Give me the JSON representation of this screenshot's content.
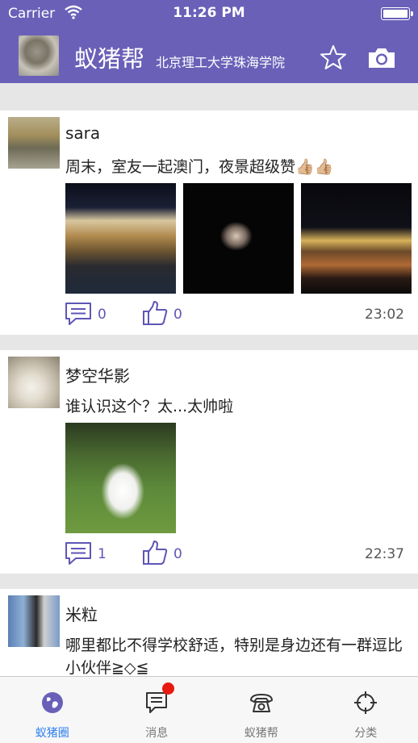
{
  "status_bar": {
    "carrier": "Carrier",
    "time": "11:26 PM"
  },
  "header": {
    "title": "蚁猪帮",
    "subtitle": "北京理工大学珠海学院"
  },
  "posts": [
    {
      "author": "sara",
      "text": "周末，室友一起澳门，夜景超级赞👍🏼👍🏼",
      "comments": "0",
      "likes": "0",
      "time": "23:02"
    },
    {
      "author": "梦空华影",
      "text": "谁认识这个？太...太帅啦",
      "comments": "1",
      "likes": "0",
      "time": "22:37"
    },
    {
      "author": "米粒",
      "text": "哪里都比不得学校舒适，特别是身边还有一群逗比小伙伴≧◇≦"
    }
  ],
  "tabs": [
    {
      "label": "蚁猪圈",
      "icon": "globe-icon",
      "active": true
    },
    {
      "label": "消息",
      "icon": "message-icon"
    },
    {
      "label": "蚁猪帮",
      "icon": "telephone-icon"
    },
    {
      "label": "分类",
      "icon": "crosshair-icon"
    }
  ],
  "colors": {
    "brand": "#6a60b8",
    "accent_text": "#5e56b6",
    "active_tab": "#2d7ff0",
    "badge": "#e8190f"
  }
}
